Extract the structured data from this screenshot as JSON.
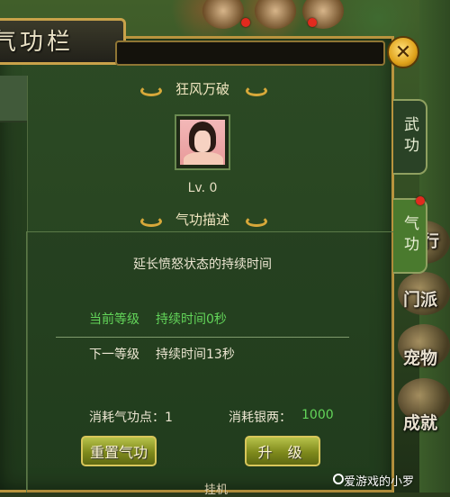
{
  "panel": {
    "title": "气功栏"
  },
  "skill": {
    "name": "狂风万破",
    "level": "Lv. 0",
    "desc_heading": "气功描述",
    "description": "延长愤怒状态的持续时间",
    "current_level_label": "当前等级",
    "current_level_value": "持续时间0秒",
    "next_level_label": "下一等级",
    "next_level_value": "持续时间13秒"
  },
  "costs": {
    "qi_points_label": "消耗气功点：1",
    "silver_label": "消耗银两：",
    "silver_value": "1000"
  },
  "buttons": {
    "reset": "重置气功",
    "upgrade": "升 级"
  },
  "tabs": [
    {
      "label": "武功"
    },
    {
      "label": "气功"
    }
  ],
  "side_menu": [
    {
      "label": "排行榜"
    },
    {
      "label": "门派"
    },
    {
      "label": "宠物"
    },
    {
      "label": "成就"
    }
  ],
  "bottom_tab": "挂机",
  "watermark": "爱游戏的小罗",
  "colors": {
    "accent_green": "#63d65a",
    "panel_border": "#b9943e",
    "button_gold": "#d8c65a"
  }
}
